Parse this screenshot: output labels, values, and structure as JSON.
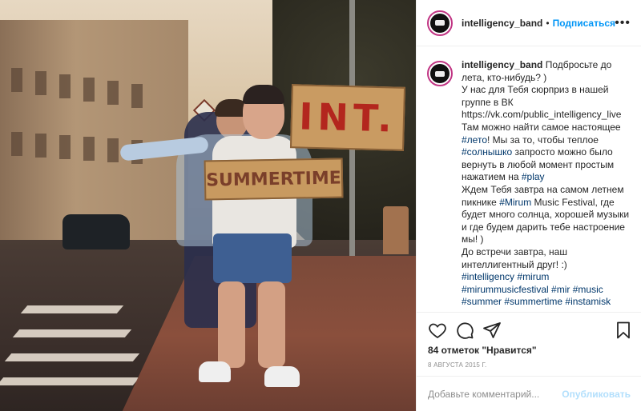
{
  "photo": {
    "sign_int": "INT.",
    "sign_summer": "SUMMERTIME"
  },
  "header": {
    "username": "intelligency_band",
    "separator": "•",
    "follow_label": "Подписаться",
    "more_icon": "ellipsis-icon"
  },
  "caption": {
    "username": "intelligency_band",
    "segments": [
      {
        "t": " Подбросьте до лета, кто-нибудь? )",
        "type": "text"
      },
      {
        "t": "\nУ нас для Тебя сюрприз в нашей группе в ВК\nhttps://vk.com/public_intelligency_live\nТам можно найти самое настоящее ",
        "type": "text"
      },
      {
        "t": "#лето",
        "type": "tag"
      },
      {
        "t": "! Мы за то, чтобы теплое ",
        "type": "text"
      },
      {
        "t": "#солнышко",
        "type": "tag"
      },
      {
        "t": " запросто можно было вернуть в любой момент простым нажатием на ",
        "type": "text"
      },
      {
        "t": "#play",
        "type": "tag"
      },
      {
        "t": "\nЖдем Тебя завтра на самом летнем пикнике ",
        "type": "text"
      },
      {
        "t": "#Mirum",
        "type": "tag"
      },
      {
        "t": " Music Festival, где будет много солнца, хорошей музыки и где будем дарить тебе настроение мы! )\nДо встречи завтра, наш интеллигентный друг! :)\n",
        "type": "text"
      },
      {
        "t": "#intelligency",
        "type": "tag"
      },
      {
        "t": " ",
        "type": "text"
      },
      {
        "t": "#mirum",
        "type": "tag"
      },
      {
        "t": "\n",
        "type": "text"
      },
      {
        "t": "#mirummusicfestival",
        "type": "tag"
      },
      {
        "t": " ",
        "type": "text"
      },
      {
        "t": "#mir",
        "type": "tag"
      },
      {
        "t": " ",
        "type": "text"
      },
      {
        "t": "#music",
        "type": "tag"
      },
      {
        "t": "\n",
        "type": "text"
      },
      {
        "t": "#summer",
        "type": "tag"
      },
      {
        "t": " ",
        "type": "text"
      },
      {
        "t": "#summertime",
        "type": "tag"
      },
      {
        "t": " ",
        "type": "text"
      },
      {
        "t": "#instamisk",
        "type": "tag"
      }
    ]
  },
  "actions": {
    "like_icon": "heart-icon",
    "comment_icon": "comment-icon",
    "share_icon": "share-icon",
    "save_icon": "bookmark-icon"
  },
  "likes": "84 отметок \"Нравится\"",
  "date": "8 АВГУСТА 2015 Г.",
  "comment_box": {
    "placeholder": "Добавьте комментарий...",
    "post_label": "Опубликовать"
  },
  "colors": {
    "follow": "#0095f6",
    "hashtag": "#00376b",
    "post_disabled": "#b2dffc",
    "avatar_ring": "#c13584"
  }
}
